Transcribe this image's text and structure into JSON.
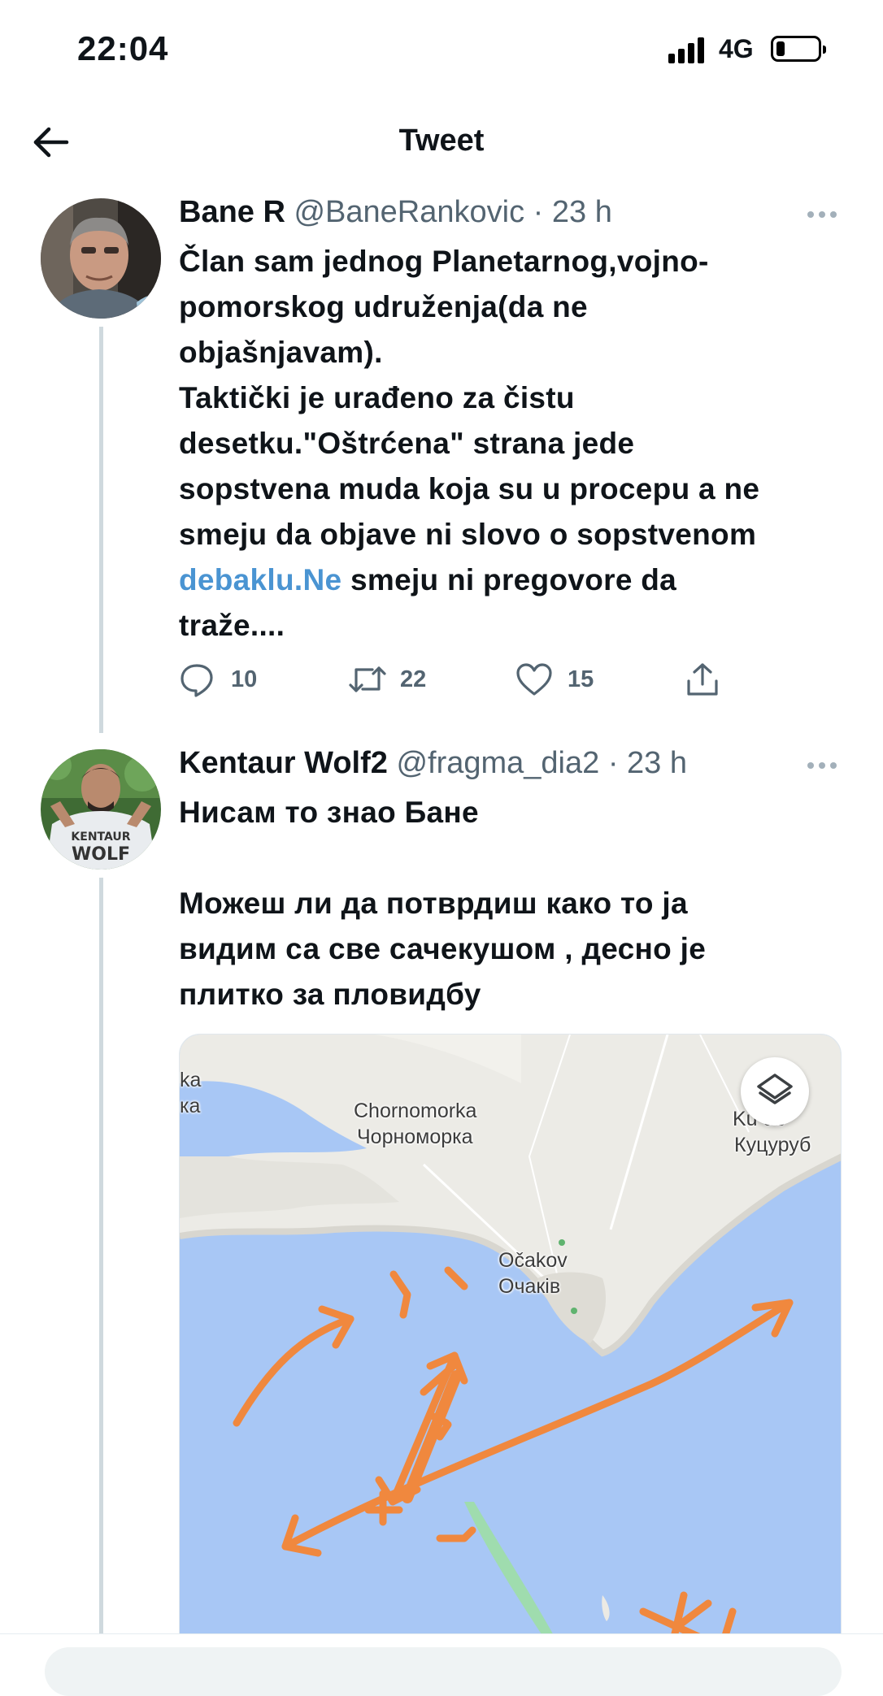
{
  "status_bar": {
    "time": "22:04",
    "network": "4G",
    "battery_level": 0.15
  },
  "header": {
    "title": "Tweet",
    "back_icon": "arrow-left-icon"
  },
  "tweets": [
    {
      "name": "Bane R",
      "handle": "@BaneRankovic",
      "time": "· 23 h",
      "text_lines": [
        "Član sam jednog Planetarnog,vojno-",
        "pomorskog udruženja(da ne",
        "objašnjavam).",
        "Taktički je urađeno za čistu",
        "desetku.\"Oštrćena\" strana jede",
        "sopstvena muda koja su u procepu a ne",
        "smeju da objave ni slovo o sopstvenom"
      ],
      "link_text": "debaklu.Ne",
      "after_link": " smeju ni pregovore da",
      "last_line": "traže....",
      "actions": {
        "replies": "10",
        "retweets": "22",
        "likes": "15"
      }
    },
    {
      "name": "Kentaur Wolf2",
      "handle": "@fragma_dia2",
      "time": "· 23 h",
      "text_lines": [
        "Нисам то знао Бане",
        "",
        "Можеш ли да потврдиш како то ја",
        "видим са све сачекушом , десно је",
        "плитко за пловидбу"
      ],
      "avatar_shirt_text": "KENTAUR WOLF"
    }
  ],
  "map": {
    "labels": {
      "partial_top": "ka",
      "partial_second": "ка",
      "chornomorka_latin": "Chornomorka",
      "chornomorka_cyrillic": "Чорноморка",
      "kutsurub_latin": "Ku   ub",
      "kutsurub_cyrillic": "Куцуруб",
      "ochakiv_latin": "Očakov",
      "ochakiv_cyrillic": "Очаків"
    },
    "colors": {
      "water": "#a8c7f5",
      "land": "#eceae4",
      "annotation": "#f0883e"
    },
    "layers_icon": "layers-icon"
  },
  "colors": {
    "link": "#4a94d2",
    "muted": "#536471",
    "thread_line": "#cfd9de"
  }
}
